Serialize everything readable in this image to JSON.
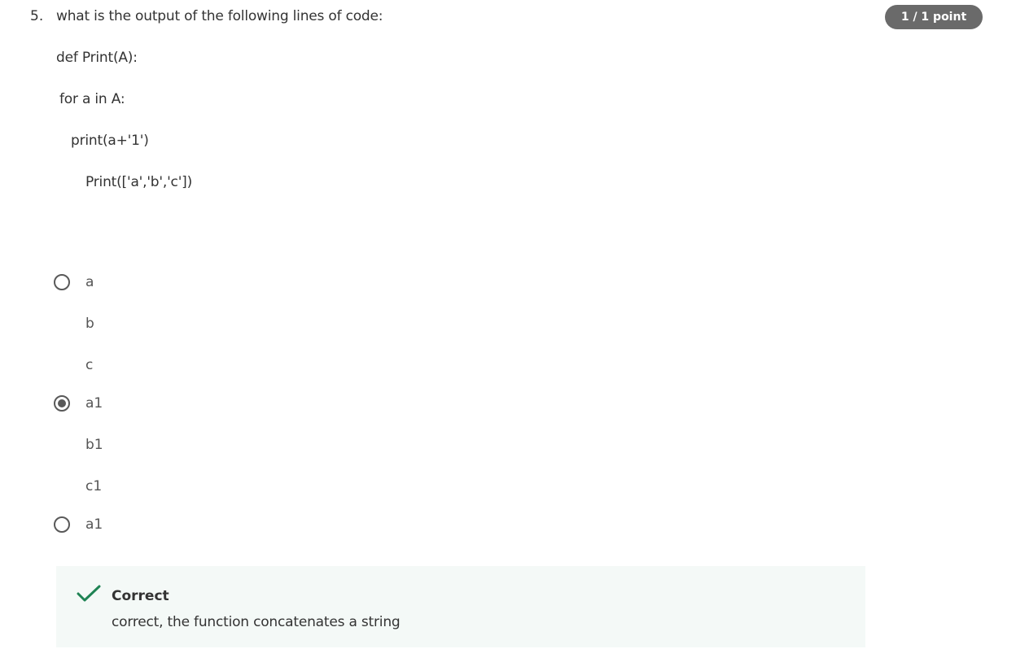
{
  "question": {
    "number": "5.",
    "text": "what is the output of the following lines of code:",
    "points": "1 / 1 point",
    "code_lines": [
      "def Print(A):",
      "for a in A:",
      "print(a+'1')",
      "Print(['a','b','c'])"
    ]
  },
  "options": [
    {
      "lines": [
        "a",
        "b",
        "c"
      ],
      "selected": false
    },
    {
      "lines": [
        "a1",
        "b1",
        "c1"
      ],
      "selected": true
    },
    {
      "lines": [
        "a1"
      ],
      "selected": false
    }
  ],
  "feedback": {
    "status": "Correct",
    "message": "correct, the function concatenates a string",
    "icon": "checkmark-icon",
    "color": "#1f8354"
  }
}
